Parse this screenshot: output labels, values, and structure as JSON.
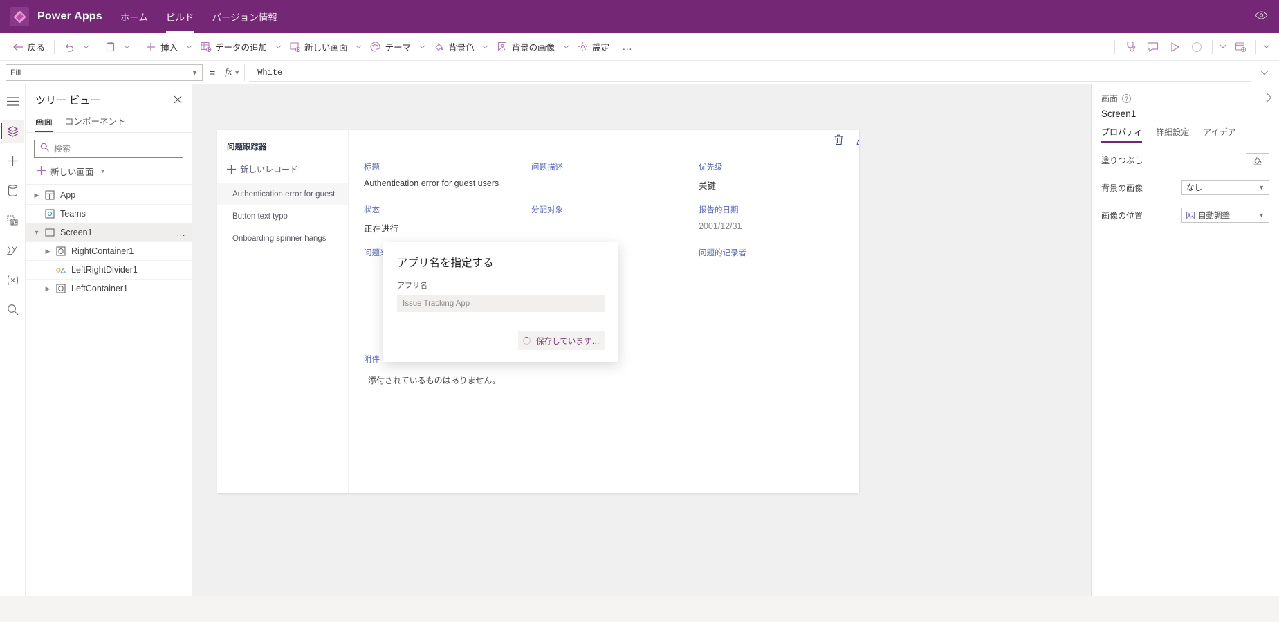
{
  "header": {
    "brand": "Power Apps",
    "nav": [
      {
        "label": "ホーム",
        "active": false
      },
      {
        "label": "ビルド",
        "active": true
      },
      {
        "label": "バージョン情報",
        "active": false
      }
    ],
    "eye_icon": "eye-icon"
  },
  "toolbar": {
    "back": "戻る",
    "undo_icon": "undo-icon",
    "paste_icon": "paste-icon",
    "insert": "挿入",
    "add_data": "データの追加",
    "new_screen": "新しい画面",
    "theme": "テーマ",
    "background_color": "背景色",
    "background_image": "背景の画像",
    "settings": "設定",
    "overflow": "…",
    "right_icons": [
      "app-checker-icon",
      "comment-icon",
      "play-icon",
      "circle-icon",
      "chevron-down-icon",
      "save-icon",
      "chevron-down-icon"
    ]
  },
  "formula_bar": {
    "property": "Fill",
    "equals": "=",
    "fx": "fx",
    "value": "White",
    "expand_icon": "chevron-down-icon"
  },
  "rail": {
    "items": [
      {
        "name": "menu-icon",
        "active": false
      },
      {
        "name": "tree-view-icon",
        "active": true
      },
      {
        "name": "insert-icon",
        "active": false
      },
      {
        "name": "data-icon",
        "active": false
      },
      {
        "name": "media-icon",
        "active": false
      },
      {
        "name": "power-automate-icon",
        "active": false
      },
      {
        "name": "variables-icon",
        "active": false
      },
      {
        "name": "search-icon",
        "active": false
      }
    ]
  },
  "tree_panel": {
    "title": "ツリー ビュー",
    "close_icon": "close-icon",
    "tabs": [
      {
        "label": "画面",
        "active": true
      },
      {
        "label": "コンポーネント",
        "active": false
      }
    ],
    "search_placeholder": "検索",
    "search_value": "",
    "new_screen": "新しい画面",
    "nodes": [
      {
        "label": "App",
        "indent": 0,
        "chevron": true,
        "icon": "app-icon",
        "selected": false
      },
      {
        "label": "Teams",
        "indent": 0,
        "chevron": false,
        "icon": "teams-icon",
        "selected": false
      },
      {
        "label": "Screen1",
        "indent": 0,
        "chevron": true,
        "expanded": true,
        "icon": "screen-icon",
        "selected": true,
        "dots": "…"
      },
      {
        "label": "RightContainer1",
        "indent": 1,
        "chevron": true,
        "icon": "container-icon",
        "selected": false
      },
      {
        "label": "LeftRightDivider1",
        "indent": 1,
        "chevron": false,
        "icon": "divider-icon",
        "selected": false
      },
      {
        "label": "LeftContainer1",
        "indent": 1,
        "chevron": true,
        "icon": "container-icon",
        "selected": false
      }
    ]
  },
  "canvas_app": {
    "title": "问题跟踪器",
    "new_record": "新しいレコード",
    "records": [
      {
        "label": "Authentication error for guest",
        "selected": true
      },
      {
        "label": "Button text typo",
        "selected": false
      },
      {
        "label": "Onboarding spinner hangs",
        "selected": false
      }
    ],
    "toolbar_icons": [
      "delete-icon",
      "edit-icon"
    ],
    "fields": [
      {
        "label": "标题",
        "value": "Authentication error for guest users"
      },
      {
        "label": "问题描述",
        "value": ""
      },
      {
        "label": "优先级",
        "value": "关键"
      },
      {
        "label": "状态",
        "value": "正在进行"
      },
      {
        "label": "分配对象",
        "value": ""
      },
      {
        "label": "报告的日期",
        "value": "2001/12/31"
      },
      {
        "label": "问题来源",
        "value": ""
      },
      {
        "label": "问题的记录者",
        "value": ""
      }
    ],
    "attachment_label": "附件",
    "attachment_value": "添付されているものはありません。",
    "scroll_up_icon": "caret-up-icon",
    "scroll_down_icon": "caret-down-icon"
  },
  "modal": {
    "title": "アプリ名を指定する",
    "field_label": "アプリ名",
    "field_value": "Issue Tracking App",
    "save_label": "保存しています…",
    "spinner_icon": "spinner-icon"
  },
  "properties_panel": {
    "kind": "画面",
    "help_icon": "question-icon",
    "collapse_icon": "chevron-right-icon",
    "name": "Screen1",
    "tabs": [
      {
        "label": "プロパティ",
        "active": true
      },
      {
        "label": "詳細設定",
        "active": false
      },
      {
        "label": "アイデア",
        "active": false
      }
    ],
    "rows": [
      {
        "label": "塗りつぶし",
        "control": "swatch",
        "icon": "fill-bucket-icon",
        "value": ""
      },
      {
        "label": "背景の画像",
        "control": "select",
        "value": "なし"
      },
      {
        "label": "画像の位置",
        "control": "select",
        "value": "自動調整",
        "icon": "image-icon"
      }
    ]
  },
  "colors": {
    "brand_purple": "#742774",
    "accent": "#8e4a8e",
    "canvas_bg": "#f0f0f0",
    "field_label": "#5b6cb8"
  }
}
